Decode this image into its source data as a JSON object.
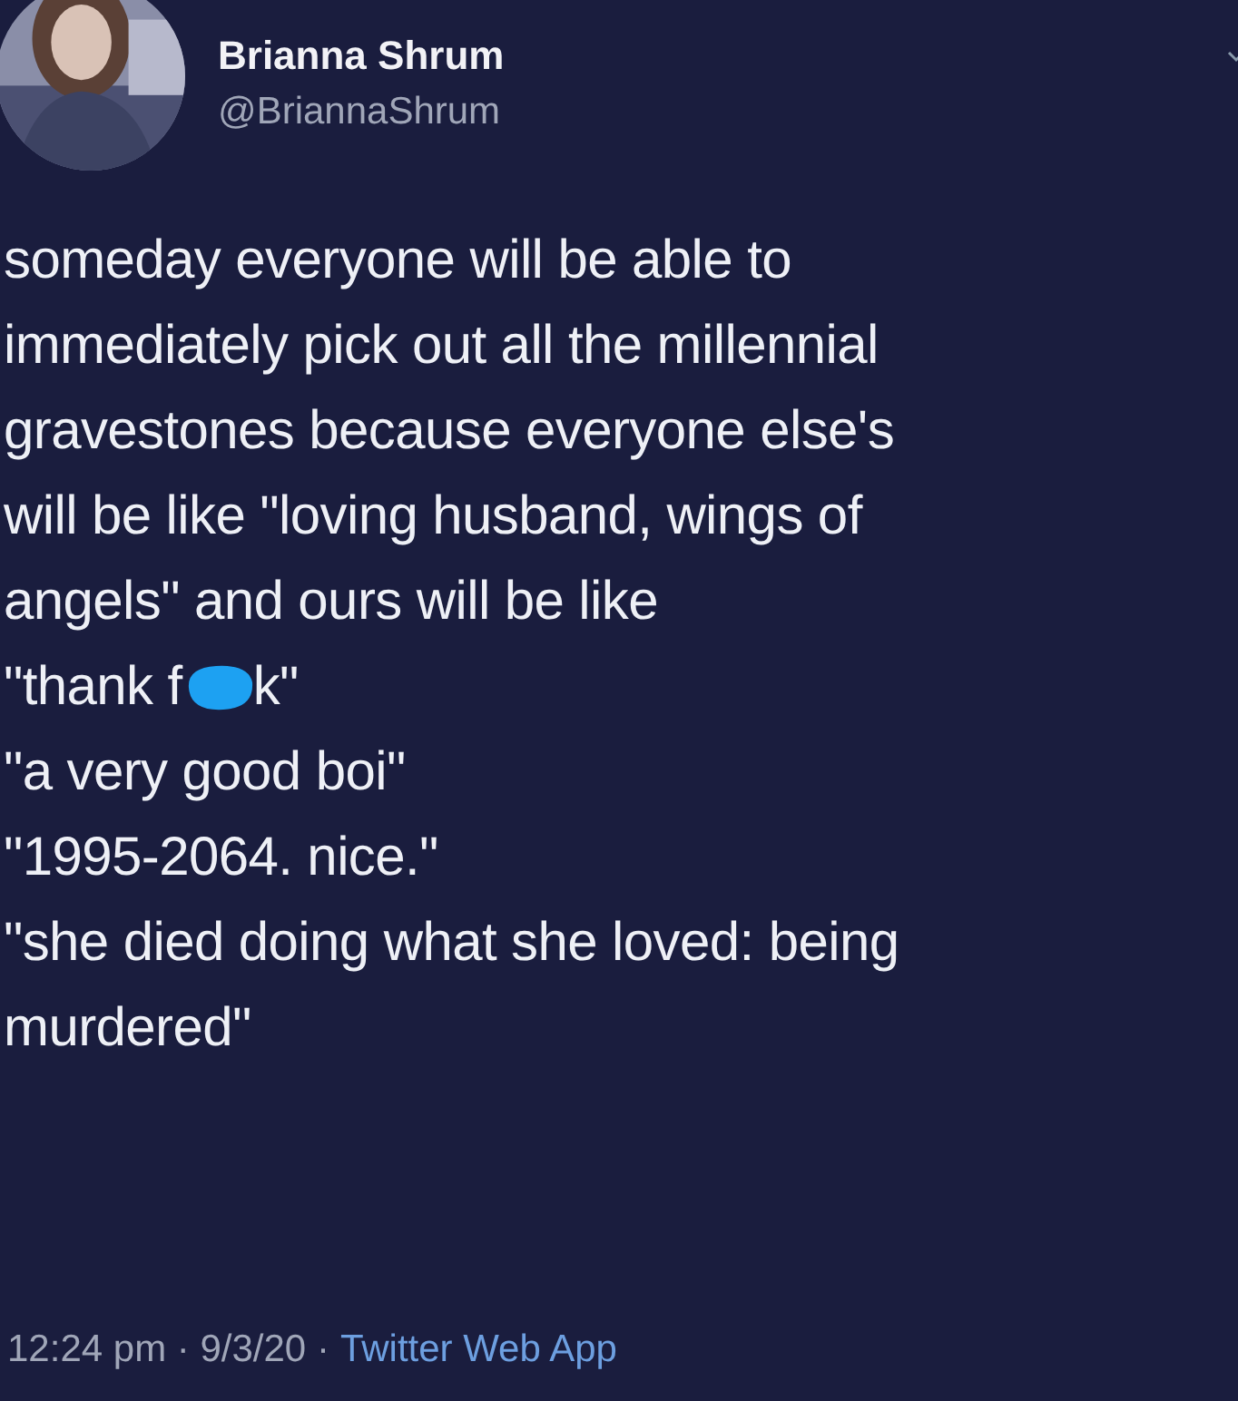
{
  "author": {
    "name": "Brianna Shrum",
    "handle": "@BriannaShrum"
  },
  "body_lines": [
    {
      "kind": "text",
      "text": "someday everyone will be able to"
    },
    {
      "kind": "text",
      "text": "immediately pick out all the millennial"
    },
    {
      "kind": "text",
      "text": "gravestones because everyone else's"
    },
    {
      "kind": "text",
      "text": "will be like \"loving husband, wings of"
    },
    {
      "kind": "text",
      "text": "angels\" and ours will be like"
    },
    {
      "kind": "censored",
      "before": "\"thank f",
      "after": "k\""
    },
    {
      "kind": "text",
      "text": "\"a very good boi\""
    },
    {
      "kind": "text",
      "text": "\"1995-2064. nice.\""
    },
    {
      "kind": "text",
      "text": "\"she died doing what she loved: being"
    },
    {
      "kind": "text",
      "text": "murdered\""
    }
  ],
  "footer": {
    "time": "12:24 pm · 9/3/20 ·",
    "source": "Twitter Web App"
  }
}
